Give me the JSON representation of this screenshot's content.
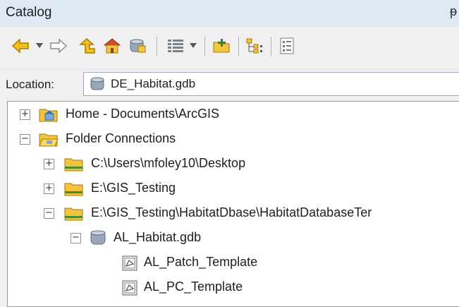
{
  "panel": {
    "title": "Catalog",
    "pin_glyph": "ᵽ"
  },
  "toolbar": {
    "items": [
      {
        "name": "back-arrow-icon"
      },
      {
        "name": "back-dropdown-icon"
      },
      {
        "name": "forward-arrow-icon"
      },
      {
        "name": "up-one-level-icon"
      },
      {
        "name": "default-home-folder-icon"
      },
      {
        "name": "default-geodatabase-icon"
      },
      {
        "name": "view-options-icon"
      },
      {
        "name": "view-options-dropdown-icon"
      },
      {
        "name": "connect-to-folder-icon"
      },
      {
        "name": "toggle-contents-panel-icon"
      },
      {
        "name": "launch-catalog-window-icon"
      }
    ]
  },
  "location": {
    "label": "Location:",
    "value": "DE_Habitat.gdb"
  },
  "tree": {
    "nodes": [
      {
        "label": "Home - Documents\\ArcGIS",
        "expander": "+",
        "icon": "home-folder-icon"
      },
      {
        "label": "Folder Connections",
        "expander": "−",
        "icon": "folder-connections-icon"
      },
      {
        "label": "C:\\Users\\mfoley10\\Desktop",
        "expander": "+",
        "icon": "folder-connection-icon"
      },
      {
        "label": "E:\\GIS_Testing",
        "expander": "+",
        "icon": "folder-connection-icon"
      },
      {
        "label": "E:\\GIS_Testing\\HabitatDbase\\HabitatDatabaseTer",
        "expander": "−",
        "icon": "folder-connection-icon"
      },
      {
        "label": "AL_Habitat.gdb",
        "expander": "−",
        "icon": "geodatabase-icon"
      },
      {
        "label": "AL_Patch_Template",
        "icon": "feature-class-icon"
      },
      {
        "label": "AL_PC_Template",
        "icon": "feature-class-icon"
      }
    ]
  },
  "colors": {
    "title_bar": "#dfe9f5",
    "folder": "#f3c440",
    "arrow": "#e8b31c"
  }
}
